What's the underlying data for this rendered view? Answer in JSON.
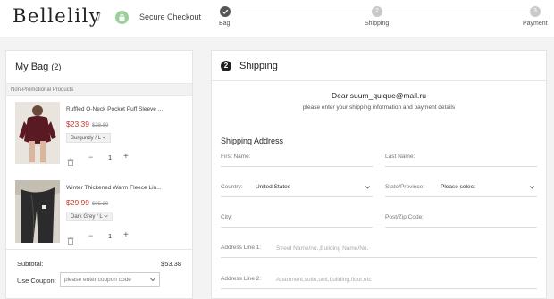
{
  "header": {
    "logo": "Bellelily",
    "separator": "/",
    "secure_checkout": "Secure Checkout",
    "steps": [
      {
        "label": "Bag",
        "number": "",
        "active": true
      },
      {
        "label": "Shipping",
        "number": "2",
        "active": false
      },
      {
        "label": "Payment",
        "number": "3",
        "active": false
      }
    ]
  },
  "bag": {
    "title": "My Bag",
    "count": "(2)",
    "promo_label": "Non-Promotional Products",
    "items": [
      {
        "title": "Ruffled O-Neck Pocket Puff Sleeve ...",
        "price": "$23.39",
        "old_price": "$28.89",
        "variant": "Burgundy / L",
        "qty": "1"
      },
      {
        "title": "Winter Thickened Warm Fleece Lin...",
        "price": "$29.99",
        "old_price": "$35.29",
        "variant": "Dark Grey / L",
        "qty": "1"
      }
    ],
    "subtotal_label": "Subtotal:",
    "subtotal_value": "$53.38",
    "coupon_label": "Use Coupon:",
    "coupon_placeholder": "please enter coupon code"
  },
  "shipping": {
    "number": "2",
    "title": "Shipping",
    "greeting": "Dear suum_quique@mail.ru",
    "instructions": "please enter your shipping information and payment details",
    "address_title": "Shipping Address",
    "fields": {
      "first_name": "First Name:",
      "last_name": "Last Name:",
      "country_label": "Country:",
      "country_value": "United States",
      "state_label": "State/Province:",
      "state_value": "Please select",
      "city": "City:",
      "zip": "Post/Zip Code:",
      "address1_label": "Address Line 1:",
      "address1_placeholder": "Street Name/no.,Building Name/No.",
      "address2_label": "Address Line 2:",
      "address2_placeholder": "Apartment,suite,unit,building,floor,etc"
    }
  },
  "colors": {
    "price_red": "#c0392b",
    "lock_green": "#9ccf9a",
    "step_active": "#555555",
    "step_inactive": "#c9c9c9"
  }
}
